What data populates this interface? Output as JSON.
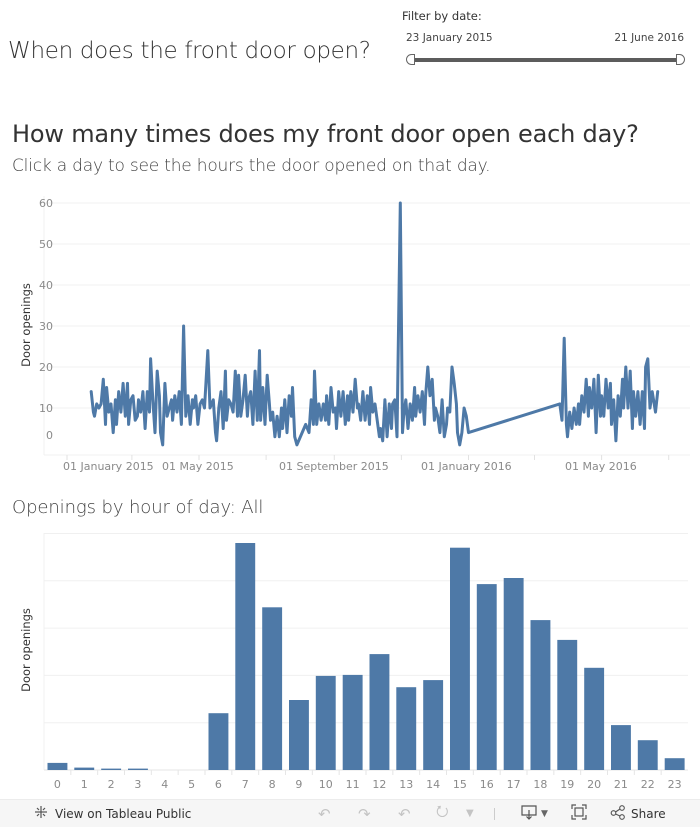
{
  "dashboard": {
    "title": "When does the front door open?"
  },
  "filter": {
    "label": "Filter by date:",
    "start": "23 January 2015",
    "end": "21 June 2016",
    "start_date": "2015-01-23",
    "end_date": "2016-06-21"
  },
  "daily_chart": {
    "title": "How many times does my front door open each day?",
    "subtitle": "Click a day to see the hours the door opened on that day."
  },
  "hourly_chart": {
    "title": "Openings by hour of day: All"
  },
  "colors": {
    "series": "#4e79a7",
    "gridline": "#f0f0f0",
    "tick_label": "#8a8a8a"
  },
  "footer": {
    "view_on_tableau": "View on Tableau Public",
    "share": "Share",
    "icons": [
      "tableau-logo-icon",
      "undo-icon",
      "redo-icon",
      "revert-icon",
      "refresh-icon",
      "dropdown-icon",
      "download-icon",
      "fullscreen-icon",
      "share-icon"
    ]
  },
  "chart_data": [
    {
      "type": "line",
      "title": "How many times does my front door open each day?",
      "xlabel": "",
      "ylabel": "Door openings",
      "ylim": [
        0,
        62
      ],
      "yticks": [
        0,
        10,
        20,
        30,
        40,
        50,
        60
      ],
      "xlim": [
        "2014-12-01",
        "2016-07-15"
      ],
      "xtick_labels": [
        {
          "date": "2015-01-01",
          "label": "01 January 2015"
        },
        {
          "date": "2015-05-01",
          "label": "01 May 2015"
        },
        {
          "date": "2015-09-01",
          "label": "01 September 2015"
        },
        {
          "date": "2016-01-01",
          "label": "01 January 2016"
        },
        {
          "date": "2016-05-01",
          "label": "01 May 2016"
        }
      ],
      "minor_ticks_every_months": 2,
      "grid": true,
      "series": [
        {
          "name": "Door openings",
          "points": [
            [
              "2015-01-23",
              14
            ],
            [
              "2015-01-25",
              9
            ],
            [
              "2015-01-26",
              8
            ],
            [
              "2015-01-28",
              11
            ],
            [
              "2015-01-30",
              10
            ],
            [
              "2015-02-01",
              11
            ],
            [
              "2015-02-03",
              17
            ],
            [
              "2015-02-05",
              6
            ],
            [
              "2015-02-06",
              15
            ],
            [
              "2015-02-08",
              9
            ],
            [
              "2015-02-10",
              11
            ],
            [
              "2015-02-12",
              4
            ],
            [
              "2015-02-14",
              12
            ],
            [
              "2015-02-15",
              6
            ],
            [
              "2015-02-17",
              14
            ],
            [
              "2015-02-19",
              9
            ],
            [
              "2015-02-21",
              16
            ],
            [
              "2015-02-23",
              8
            ],
            [
              "2015-02-25",
              16
            ],
            [
              "2015-02-26",
              6
            ],
            [
              "2015-02-28",
              12
            ],
            [
              "2015-03-02",
              13
            ],
            [
              "2015-03-04",
              7
            ],
            [
              "2015-03-06",
              8
            ],
            [
              "2015-03-07",
              12
            ],
            [
              "2015-03-09",
              9
            ],
            [
              "2015-03-11",
              14
            ],
            [
              "2015-03-13",
              5
            ],
            [
              "2015-03-15",
              14
            ],
            [
              "2015-03-17",
              9
            ],
            [
              "2015-03-18",
              22
            ],
            [
              "2015-03-20",
              12
            ],
            [
              "2015-03-22",
              4
            ],
            [
              "2015-03-24",
              19
            ],
            [
              "2015-03-26",
              13
            ],
            [
              "2015-03-27",
              4
            ],
            [
              "2015-03-29",
              1
            ],
            [
              "2015-03-31",
              16
            ],
            [
              "2015-04-02",
              8
            ],
            [
              "2015-04-04",
              10
            ],
            [
              "2015-04-06",
              12
            ],
            [
              "2015-04-07",
              7
            ],
            [
              "2015-04-09",
              13
            ],
            [
              "2015-04-11",
              9
            ],
            [
              "2015-04-13",
              14
            ],
            [
              "2015-04-15",
              6
            ],
            [
              "2015-04-17",
              30
            ],
            [
              "2015-04-19",
              8
            ],
            [
              "2015-04-21",
              13
            ],
            [
              "2015-04-23",
              6
            ],
            [
              "2015-04-25",
              12
            ],
            [
              "2015-04-26",
              10
            ],
            [
              "2015-04-28",
              13
            ],
            [
              "2015-04-30",
              6
            ],
            [
              "2015-05-02",
              11
            ],
            [
              "2015-05-04",
              12
            ],
            [
              "2015-05-06",
              10
            ],
            [
              "2015-05-09",
              24
            ],
            [
              "2015-05-11",
              10
            ],
            [
              "2015-05-14",
              12
            ],
            [
              "2015-05-16",
              4
            ],
            [
              "2015-05-17",
              2
            ],
            [
              "2015-05-19",
              10
            ],
            [
              "2015-05-21",
              14
            ],
            [
              "2015-05-23",
              5
            ],
            [
              "2015-05-25",
              19
            ],
            [
              "2015-05-26",
              7
            ],
            [
              "2015-05-28",
              12
            ],
            [
              "2015-05-30",
              11
            ],
            [
              "2015-06-01",
              9
            ],
            [
              "2015-06-03",
              19
            ],
            [
              "2015-06-05",
              8
            ],
            [
              "2015-06-06",
              18
            ],
            [
              "2015-06-08",
              8
            ],
            [
              "2015-06-10",
              12
            ],
            [
              "2015-06-12",
              18
            ],
            [
              "2015-06-14",
              8
            ],
            [
              "2015-06-15",
              12
            ],
            [
              "2015-06-17",
              14
            ],
            [
              "2015-06-19",
              6
            ],
            [
              "2015-06-21",
              19
            ],
            [
              "2015-06-23",
              7
            ],
            [
              "2015-06-25",
              24
            ],
            [
              "2015-06-26",
              7
            ],
            [
              "2015-06-28",
              15
            ],
            [
              "2015-06-30",
              6
            ],
            [
              "2015-07-02",
              18
            ],
            [
              "2015-07-04",
              11
            ],
            [
              "2015-07-05",
              7
            ],
            [
              "2015-07-07",
              9
            ],
            [
              "2015-07-09",
              3
            ],
            [
              "2015-07-11",
              8
            ],
            [
              "2015-07-13",
              3
            ],
            [
              "2015-07-15",
              10
            ],
            [
              "2015-07-16",
              5
            ],
            [
              "2015-07-18",
              12
            ],
            [
              "2015-07-20",
              4
            ],
            [
              "2015-07-22",
              13
            ],
            [
              "2015-07-24",
              8
            ],
            [
              "2015-07-25",
              15
            ],
            [
              "2015-07-27",
              3
            ],
            [
              "2015-07-29",
              1
            ],
            [
              "2015-08-06",
              6
            ],
            [
              "2015-08-09",
              4
            ],
            [
              "2015-08-11",
              12
            ],
            [
              "2015-08-13",
              6
            ],
            [
              "2015-08-14",
              19
            ],
            [
              "2015-08-16",
              6
            ],
            [
              "2015-08-18",
              11
            ],
            [
              "2015-08-20",
              7
            ],
            [
              "2015-08-22",
              11
            ],
            [
              "2015-08-24",
              7
            ],
            [
              "2015-08-25",
              13
            ],
            [
              "2015-08-27",
              6
            ],
            [
              "2015-08-29",
              15
            ],
            [
              "2015-08-31",
              9
            ],
            [
              "2015-09-02",
              10
            ],
            [
              "2015-09-03",
              5
            ],
            [
              "2015-09-05",
              14
            ],
            [
              "2015-09-07",
              8
            ],
            [
              "2015-09-09",
              14
            ],
            [
              "2015-09-11",
              6
            ],
            [
              "2015-09-13",
              13
            ],
            [
              "2015-09-14",
              7
            ],
            [
              "2015-09-16",
              14
            ],
            [
              "2015-09-18",
              9
            ],
            [
              "2015-09-20",
              17
            ],
            [
              "2015-09-22",
              10
            ],
            [
              "2015-09-23",
              11
            ],
            [
              "2015-09-25",
              7
            ],
            [
              "2015-09-27",
              14
            ],
            [
              "2015-09-29",
              7
            ],
            [
              "2015-10-01",
              13
            ],
            [
              "2015-10-03",
              6
            ],
            [
              "2015-10-04",
              15
            ],
            [
              "2015-10-06",
              9
            ],
            [
              "2015-10-08",
              11
            ],
            [
              "2015-10-10",
              7
            ],
            [
              "2015-10-12",
              3
            ],
            [
              "2015-10-13",
              5
            ],
            [
              "2015-10-15",
              2
            ],
            [
              "2015-10-17",
              12
            ],
            [
              "2015-10-19",
              3
            ],
            [
              "2015-10-21",
              11
            ],
            [
              "2015-10-23",
              5
            ],
            [
              "2015-10-24",
              11
            ],
            [
              "2015-10-26",
              12
            ],
            [
              "2015-10-28",
              3
            ],
            [
              "2015-10-31",
              60
            ],
            [
              "2015-11-02",
              4
            ],
            [
              "2015-11-03",
              8
            ],
            [
              "2015-11-05",
              12
            ],
            [
              "2015-11-07",
              5
            ],
            [
              "2015-11-09",
              11
            ],
            [
              "2015-11-11",
              7
            ],
            [
              "2015-11-13",
              15
            ],
            [
              "2015-11-14",
              8
            ],
            [
              "2015-11-16",
              13
            ],
            [
              "2015-11-18",
              9
            ],
            [
              "2015-11-20",
              14
            ],
            [
              "2015-11-22",
              6
            ],
            [
              "2015-11-23",
              13
            ],
            [
              "2015-11-25",
              20
            ],
            [
              "2015-11-27",
              13
            ],
            [
              "2015-11-29",
              17
            ],
            [
              "2015-12-01",
              7
            ],
            [
              "2015-12-02",
              10
            ],
            [
              "2015-12-04",
              8
            ],
            [
              "2015-12-06",
              4
            ],
            [
              "2015-12-08",
              12
            ],
            [
              "2015-12-10",
              3
            ],
            [
              "2015-12-12",
              6
            ],
            [
              "2015-12-13",
              10
            ],
            [
              "2015-12-15",
              9
            ],
            [
              "2015-12-17",
              20
            ],
            [
              "2015-12-19",
              16
            ],
            [
              "2015-12-21",
              11
            ],
            [
              "2015-12-22",
              4
            ],
            [
              "2015-12-24",
              1
            ],
            [
              "2015-12-26",
              4
            ],
            [
              "2015-12-28",
              10
            ],
            [
              "2015-12-30",
              8
            ],
            [
              "2016-01-01",
              4
            ],
            [
              "2016-03-24",
              11
            ],
            [
              "2016-03-26",
              7
            ],
            [
              "2016-03-28",
              27
            ],
            [
              "2016-03-30",
              6
            ],
            [
              "2016-03-31",
              3
            ],
            [
              "2016-04-02",
              9
            ],
            [
              "2016-04-04",
              5
            ],
            [
              "2016-04-06",
              10
            ],
            [
              "2016-04-08",
              6
            ],
            [
              "2016-04-10",
              11
            ],
            [
              "2016-04-11",
              6
            ],
            [
              "2016-04-13",
              13
            ],
            [
              "2016-04-15",
              9
            ],
            [
              "2016-04-17",
              17
            ],
            [
              "2016-04-19",
              8
            ],
            [
              "2016-04-20",
              15
            ],
            [
              "2016-04-22",
              10
            ],
            [
              "2016-04-24",
              17
            ],
            [
              "2016-04-26",
              4
            ],
            [
              "2016-04-28",
              18
            ],
            [
              "2016-04-30",
              8
            ],
            [
              "2016-05-01",
              13
            ],
            [
              "2016-05-03",
              8
            ],
            [
              "2016-05-05",
              17
            ],
            [
              "2016-05-07",
              10
            ],
            [
              "2016-05-09",
              16
            ],
            [
              "2016-05-10",
              6
            ],
            [
              "2016-05-12",
              12
            ],
            [
              "2016-05-14",
              2
            ],
            [
              "2016-05-16",
              13
            ],
            [
              "2016-05-18",
              8
            ],
            [
              "2016-05-20",
              17
            ],
            [
              "2016-05-21",
              10
            ],
            [
              "2016-05-23",
              20
            ],
            [
              "2016-05-25",
              10
            ],
            [
              "2016-05-27",
              19
            ],
            [
              "2016-05-29",
              5
            ],
            [
              "2016-05-30",
              14
            ],
            [
              "2016-06-01",
              8
            ],
            [
              "2016-06-03",
              14
            ],
            [
              "2016-06-05",
              6
            ],
            [
              "2016-06-07",
              14
            ],
            [
              "2016-06-09",
              5
            ],
            [
              "2016-06-10",
              20
            ],
            [
              "2016-06-12",
              22
            ],
            [
              "2016-06-14",
              10
            ],
            [
              "2016-06-16",
              14
            ],
            [
              "2016-06-19",
              9
            ],
            [
              "2016-06-21",
              14
            ]
          ]
        }
      ]
    },
    {
      "type": "bar",
      "title": "Openings by hour of day: All",
      "xlabel": "",
      "ylabel": "Door openings",
      "y_units": "relative (gridline intervals; axis values not labeled)",
      "ylim": [
        0,
        5
      ],
      "categories": [
        "0",
        "1",
        "2",
        "3",
        "4",
        "5",
        "6",
        "7",
        "8",
        "9",
        "10",
        "11",
        "12",
        "13",
        "14",
        "15",
        "16",
        "17",
        "18",
        "19",
        "20",
        "21",
        "22",
        "23"
      ],
      "values": [
        0.15,
        0.05,
        0.03,
        0.03,
        0.0,
        0.0,
        1.2,
        4.8,
        3.44,
        1.48,
        1.99,
        2.01,
        2.45,
        1.75,
        1.9,
        4.7,
        3.93,
        4.06,
        3.17,
        2.75,
        2.16,
        0.95,
        0.63,
        0.25
      ],
      "grid": true
    }
  ]
}
